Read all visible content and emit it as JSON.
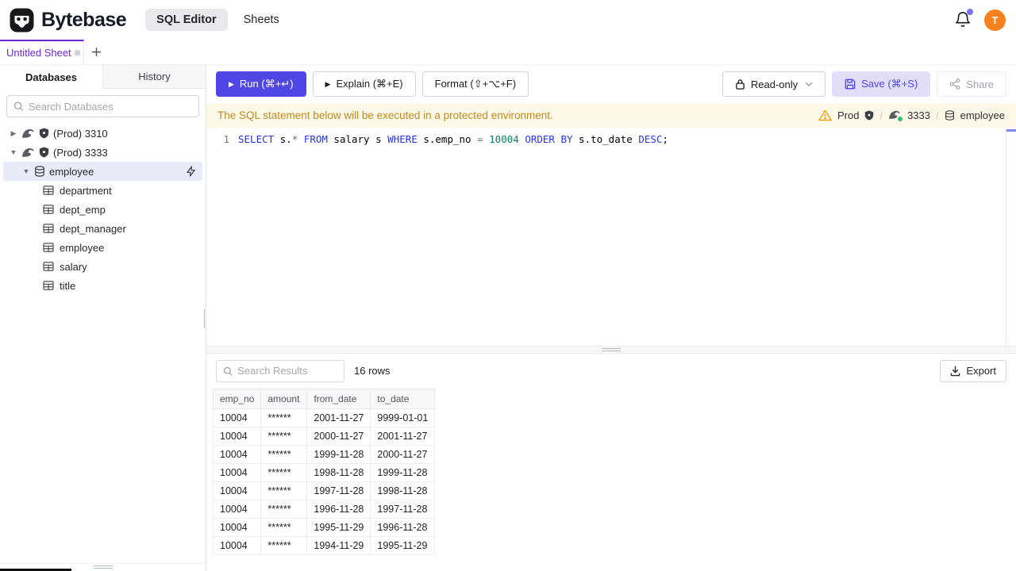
{
  "header": {
    "brand": "Bytebase",
    "nav": [
      {
        "label": "SQL Editor",
        "active": true
      },
      {
        "label": "Sheets",
        "active": false
      }
    ],
    "avatar_letter": "T"
  },
  "tabbar": {
    "tabs": [
      {
        "label": "Untitled Sheet",
        "dirty": true
      }
    ]
  },
  "sidebar": {
    "tabs": [
      {
        "label": "Databases",
        "active": true
      },
      {
        "label": "History",
        "active": false
      }
    ],
    "search_placeholder": "Search Databases",
    "tree": {
      "instances": [
        {
          "label": "(Prod) 3310",
          "expanded": false
        },
        {
          "label": "(Prod) 3333",
          "expanded": true
        }
      ],
      "database": {
        "label": "employee",
        "selected": true
      },
      "tables": [
        "department",
        "dept_emp",
        "dept_manager",
        "employee",
        "salary",
        "title"
      ]
    }
  },
  "toolbar": {
    "run_label": "Run (⌘+↵)",
    "explain_label": "Explain (⌘+E)",
    "format_label": "Format (⇧+⌥+F)",
    "readonly_label": "Read-only",
    "save_label": "Save (⌘+S)",
    "share_label": "Share"
  },
  "banner": {
    "message": "The SQL statement below will be executed in a protected environment.",
    "environment": "Prod",
    "instance": "3333",
    "database": "employee",
    "separator": "/"
  },
  "editor": {
    "line_number": "1",
    "sql_text": "SELECT s.* FROM salary s WHERE s.emp_no = 10004 ORDER BY s.to_date DESC;",
    "tokens": [
      {
        "t": "SELECT",
        "c": "kw"
      },
      {
        "t": " s.",
        "c": "id"
      },
      {
        "t": "*",
        "c": "op"
      },
      {
        "t": " ",
        "c": "id"
      },
      {
        "t": "FROM",
        "c": "kw"
      },
      {
        "t": " salary s ",
        "c": "id"
      },
      {
        "t": "WHERE",
        "c": "kw"
      },
      {
        "t": " s.emp_no ",
        "c": "id"
      },
      {
        "t": "=",
        "c": "op"
      },
      {
        "t": " ",
        "c": "id"
      },
      {
        "t": "10004",
        "c": "num"
      },
      {
        "t": " ",
        "c": "id"
      },
      {
        "t": "ORDER BY",
        "c": "kw"
      },
      {
        "t": " s.to_date ",
        "c": "id"
      },
      {
        "t": "DESC",
        "c": "kw"
      },
      {
        "t": ";",
        "c": "id"
      }
    ]
  },
  "results": {
    "search_placeholder": "Search Results",
    "row_count_label": "16 rows",
    "export_label": "Export",
    "columns": [
      "emp_no",
      "amount",
      "from_date",
      "to_date"
    ],
    "rows": [
      [
        "10004",
        "******",
        "2001-11-27",
        "9999-01-01"
      ],
      [
        "10004",
        "******",
        "2000-11-27",
        "2001-11-27"
      ],
      [
        "10004",
        "******",
        "1999-11-28",
        "2000-11-27"
      ],
      [
        "10004",
        "******",
        "1998-11-28",
        "1999-11-28"
      ],
      [
        "10004",
        "******",
        "1997-11-28",
        "1998-11-28"
      ],
      [
        "10004",
        "******",
        "1996-11-28",
        "1997-11-28"
      ],
      [
        "10004",
        "******",
        "1995-11-29",
        "1996-11-28"
      ],
      [
        "10004",
        "******",
        "1994-11-29",
        "1995-11-29"
      ]
    ]
  },
  "icons": {
    "logo": "bytebase-face-mark",
    "bell": "notification-bell",
    "search": "magnifier",
    "caret_right": "▸",
    "caret_down": "▾",
    "mysql": "dolphin",
    "shield": "protected-shield",
    "database": "cylinder",
    "table": "grid",
    "bolt": "lightning",
    "play": "▶",
    "lock": "padlock",
    "chevron_down": "⌄",
    "save": "floppy-disk",
    "share": "share-nodes",
    "warning": "⚠",
    "download": "download-tray",
    "plus": "+"
  },
  "colors": {
    "accent_indigo": "#4f46e5",
    "tab_purple": "#6d28d9",
    "avatar_orange": "#f6821f",
    "banner_bg": "#fdf9e8",
    "banner_text": "#bd8a1f",
    "keyword_blue": "#2533ee",
    "number_green": "#098658",
    "selected_row_bg": "#e9ebf8",
    "warning_orange": "#f59e0b",
    "online_green": "#2fbf71"
  }
}
